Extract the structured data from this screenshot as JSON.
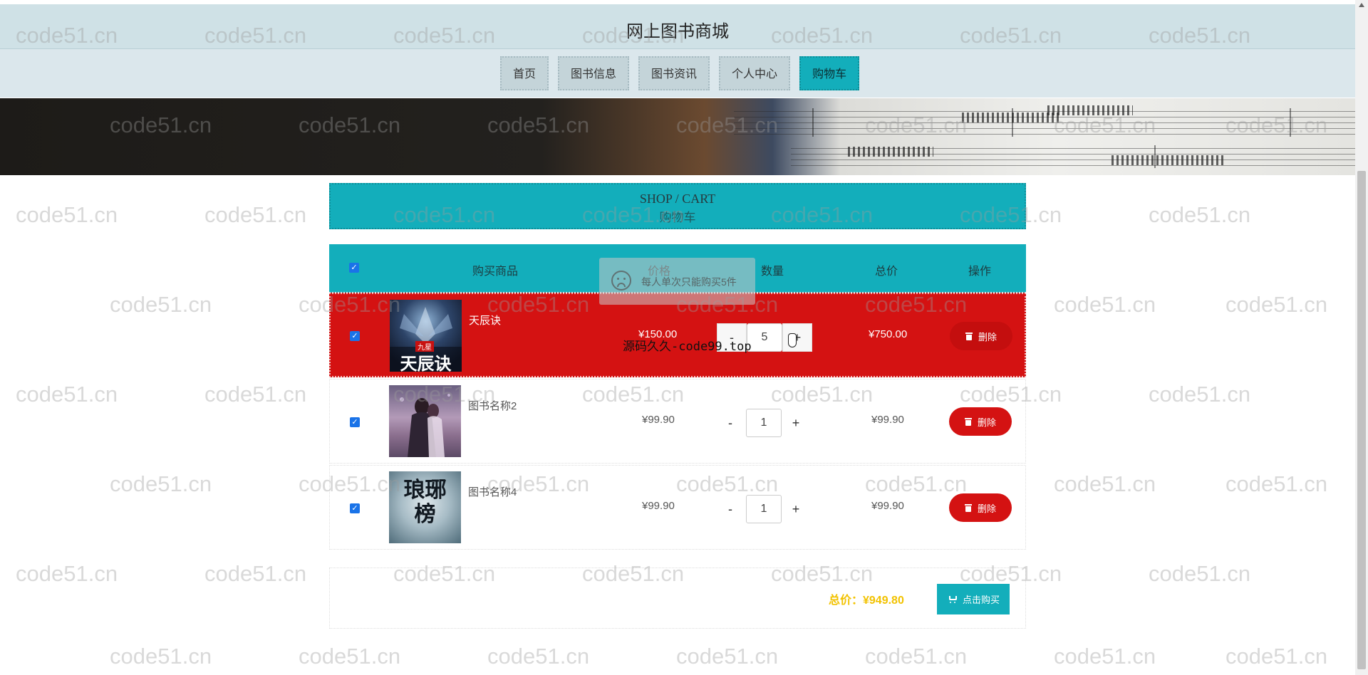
{
  "site_title": "网上图书商城",
  "nav": [
    {
      "label": "首页",
      "active": false
    },
    {
      "label": "图书信息",
      "active": false
    },
    {
      "label": "图书资讯",
      "active": false
    },
    {
      "label": "个人中心",
      "active": false
    },
    {
      "label": "购物车",
      "active": true
    }
  ],
  "cart": {
    "heading_en": "SHOP / CART",
    "heading_cn": "购物车",
    "columns": {
      "product": "购买商品",
      "price": "价格",
      "quantity": "数量",
      "total": "总价",
      "action": "操作"
    },
    "select_all_checked": true,
    "qty_minus": "-",
    "qty_plus": "+",
    "delete_label": "删除",
    "items": [
      {
        "name": "天辰诀",
        "price": "¥150.00",
        "quantity": "5",
        "total": "¥750.00",
        "checked": true,
        "highlighted": true,
        "cover_text": "天辰诀",
        "cover_tag": "九星"
      },
      {
        "name": "图书名称2",
        "price": "¥99.90",
        "quantity": "1",
        "total": "¥99.90",
        "checked": true,
        "highlighted": false
      },
      {
        "name": "图书名称4",
        "price": "¥99.90",
        "quantity": "1",
        "total": "¥99.90",
        "checked": true,
        "highlighted": false,
        "cover_text": "琅琊榜"
      }
    ],
    "sum_label": "总价：¥949.80",
    "buy_label": "点击购买"
  },
  "toast": {
    "message": "每人单次只能购买5件"
  },
  "overlay_text": "源码久久-code99.top",
  "watermark": "code51.cn",
  "colors": {
    "accent": "#13aebb",
    "danger": "#d41212",
    "sum": "#f2c200",
    "header": "#cfe1e6",
    "nav": "#dbe7ec"
  }
}
